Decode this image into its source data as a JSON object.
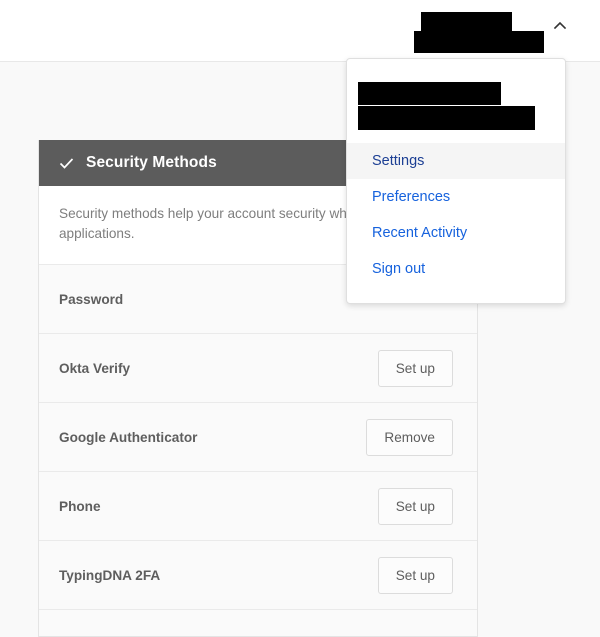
{
  "topbar": {
    "user_menu": {
      "name_redacted": true,
      "chevron_icon": "chevron-up-icon"
    }
  },
  "dropdown": {
    "account_name_redacted": true,
    "account_email_redacted": true,
    "items": [
      {
        "label": "Settings",
        "active": true
      },
      {
        "label": "Preferences",
        "active": false
      },
      {
        "label": "Recent Activity",
        "active": false
      },
      {
        "label": "Sign out",
        "active": false
      }
    ],
    "link_color": "#1662dd",
    "active_link_color": "#1c3f94",
    "active_background": "#f5f5f5"
  },
  "card": {
    "header": {
      "icon": "check-icon",
      "title": "Security Methods",
      "background": "#5c5c5c"
    },
    "description": "Security methods help your account security when and other applications.",
    "rows": [
      {
        "name": "Password",
        "action": ""
      },
      {
        "name": "Okta Verify",
        "action": "Set up"
      },
      {
        "name": "Google Authenticator",
        "action": "Remove"
      },
      {
        "name": "Phone",
        "action": "Set up"
      },
      {
        "name": "TypingDNA 2FA",
        "action": "Set up"
      }
    ]
  },
  "colors": {
    "page_background": "#f9f9f9",
    "topbar_background": "#ffffff",
    "row_background": "#fafafa",
    "divider": "#eaeaea"
  }
}
